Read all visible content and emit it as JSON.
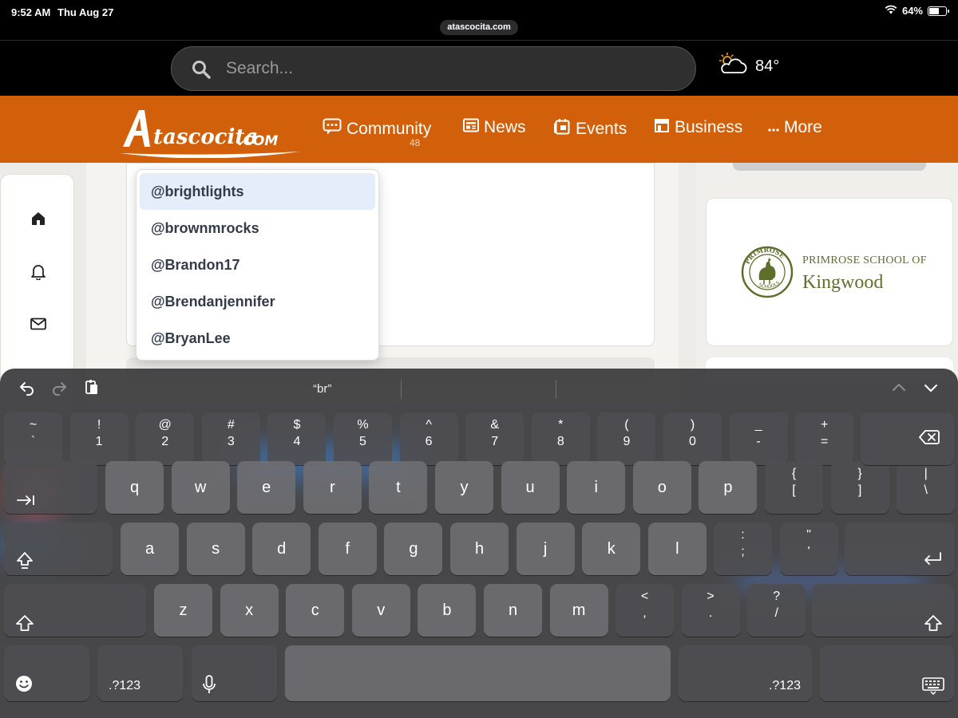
{
  "status_bar": {
    "time": "9:52 AM",
    "date": "Thu Aug 27",
    "battery": "64%",
    "battery_level": 0.64,
    "url": "atascocita.com"
  },
  "search": {
    "placeholder": "Search..."
  },
  "weather": {
    "temp": "84°",
    "icon": "partly-cloudy-sun-icon"
  },
  "brand": {
    "logo_text": "Atascocita.com",
    "accent_color": "#d2600a"
  },
  "nav": {
    "items": [
      {
        "label": "Community",
        "icon": "chat-icon",
        "count": "48"
      },
      {
        "label": "News",
        "icon": "newspaper-icon"
      },
      {
        "label": "Events",
        "icon": "calendar-icon"
      },
      {
        "label": "Business",
        "icon": "storefront-icon"
      },
      {
        "label": "More",
        "icon": "ellipsis-icon"
      }
    ]
  },
  "sidebar": {
    "icons": [
      "home-icon",
      "bell-icon",
      "mail-icon"
    ]
  },
  "ad": {
    "line1": "PRIMROSE SCHOOL OF",
    "line2": "Kingwood",
    "badge_top": "PRIMROSE",
    "badge_bottom": "SCHOOLS"
  },
  "mentions": {
    "items": [
      "@brightlights",
      "@brownmrocks",
      "@Brandon17",
      "@Brendanjennifer",
      "@BryanLee"
    ],
    "active_index": 0
  },
  "keyboard": {
    "prediction": "“br”",
    "row1": [
      {
        "top": "~",
        "bottom": "`"
      },
      {
        "top": "!",
        "bottom": "1"
      },
      {
        "top": "@",
        "bottom": "2"
      },
      {
        "top": "#",
        "bottom": "3"
      },
      {
        "top": "$",
        "bottom": "4"
      },
      {
        "top": "%",
        "bottom": "5"
      },
      {
        "top": "^",
        "bottom": "6"
      },
      {
        "top": "&",
        "bottom": "7"
      },
      {
        "top": "*",
        "bottom": "8"
      },
      {
        "top": "(",
        "bottom": "9"
      },
      {
        "top": ")",
        "bottom": "0"
      },
      {
        "top": "_",
        "bottom": "-"
      },
      {
        "top": "+",
        "bottom": "="
      }
    ],
    "row2": [
      "q",
      "w",
      "e",
      "r",
      "t",
      "y",
      "u",
      "i",
      "o",
      "p"
    ],
    "row2_extra": [
      {
        "top": "{",
        "bottom": "["
      },
      {
        "top": "}",
        "bottom": "]"
      },
      {
        "top": "|",
        "bottom": "\\"
      }
    ],
    "row3": [
      "a",
      "s",
      "d",
      "f",
      "g",
      "h",
      "j",
      "k",
      "l"
    ],
    "row3_extra": [
      {
        "top": ":",
        "bottom": ";"
      },
      {
        "top": "\"",
        "bottom": "'"
      }
    ],
    "row4": [
      "z",
      "x",
      "c",
      "v",
      "b",
      "n",
      "m"
    ],
    "row4_extra": [
      {
        "top": "<",
        "bottom": ","
      },
      {
        "top": ">",
        "bottom": "."
      },
      {
        "top": "?",
        "bottom": "/"
      }
    ],
    "numbers_label": ".?123"
  }
}
